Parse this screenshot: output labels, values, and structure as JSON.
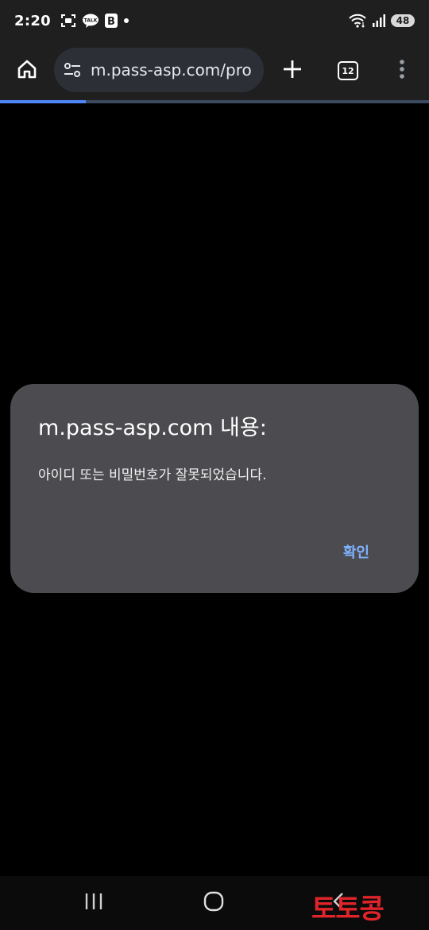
{
  "status_bar": {
    "time": "2:20",
    "left_icons": [
      "screenshot-icon",
      "kakaotalk-icon",
      "b-app-icon",
      "dot-icon"
    ],
    "talk_text": "TALK",
    "b_letter": "B",
    "battery": "48"
  },
  "browser": {
    "url": "m.pass-asp.com/pro",
    "tab_count": "12",
    "progress_fraction": 0.2
  },
  "dialog": {
    "title": "m.pass-asp.com 내용:",
    "message": "아이디 또는 비밀번호가 잘못되었습니다.",
    "ok_label": "확인"
  },
  "watermark": {
    "text": "토토콩"
  },
  "colors": {
    "accent": "#4f86f7",
    "dialog_bg": "#4c4b4f",
    "ok_button": "#7fb2ff",
    "watermark": "#e0242a"
  }
}
